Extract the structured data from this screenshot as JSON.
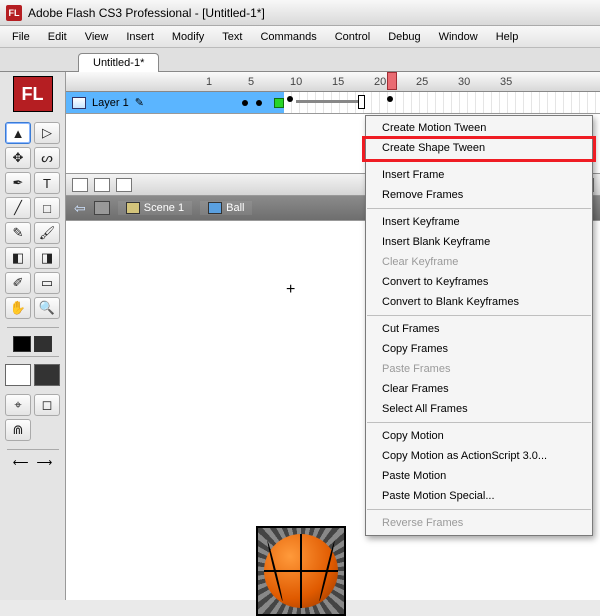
{
  "titlebar": {
    "app": "FL",
    "title": "Adobe Flash CS3 Professional - [Untitled-1*]"
  },
  "menubar": [
    "File",
    "Edit",
    "View",
    "Insert",
    "Modify",
    "Text",
    "Commands",
    "Control",
    "Debug",
    "Window",
    "Help"
  ],
  "tab": "Untitled-1*",
  "timeline": {
    "layer": "Layer 1",
    "nums": [
      "1",
      "5",
      "10",
      "15",
      "20",
      "25",
      "30",
      "35"
    ]
  },
  "breadcrumb": {
    "scene": "Scene 1",
    "symbol": "Ball"
  },
  "context": {
    "items": [
      {
        "label": "Create Motion Tween",
        "dis": false
      },
      {
        "label": "Create Shape Tween",
        "dis": false,
        "hl": true
      },
      {
        "sep": true
      },
      {
        "label": "Insert Frame",
        "dis": false
      },
      {
        "label": "Remove Frames",
        "dis": false
      },
      {
        "sep": true
      },
      {
        "label": "Insert Keyframe",
        "dis": false
      },
      {
        "label": "Insert Blank Keyframe",
        "dis": false
      },
      {
        "label": "Clear Keyframe",
        "dis": true
      },
      {
        "label": "Convert to Keyframes",
        "dis": false
      },
      {
        "label": "Convert to Blank Keyframes",
        "dis": false
      },
      {
        "sep": true
      },
      {
        "label": "Cut Frames",
        "dis": false
      },
      {
        "label": "Copy Frames",
        "dis": false
      },
      {
        "label": "Paste Frames",
        "dis": true
      },
      {
        "label": "Clear Frames",
        "dis": false
      },
      {
        "label": "Select All Frames",
        "dis": false
      },
      {
        "sep": true
      },
      {
        "label": "Copy Motion",
        "dis": false
      },
      {
        "label": "Copy Motion as ActionScript 3.0...",
        "dis": false
      },
      {
        "label": "Paste Motion",
        "dis": false
      },
      {
        "label": "Paste Motion Special...",
        "dis": false
      },
      {
        "sep": true
      },
      {
        "label": "Reverse Frames",
        "dis": true
      }
    ]
  },
  "tools": {
    "badge": "FL",
    "items": [
      {
        "n": "selection",
        "g": "▲",
        "sel": true
      },
      {
        "n": "subselect",
        "g": "▷"
      },
      {
        "n": "free-transform",
        "g": "✥"
      },
      {
        "n": "lasso",
        "g": "ᔕ"
      },
      {
        "n": "pen",
        "g": "✒"
      },
      {
        "n": "text",
        "g": "T"
      },
      {
        "n": "line",
        "g": "╱"
      },
      {
        "n": "rectangle",
        "g": "□"
      },
      {
        "n": "pencil",
        "g": "✎"
      },
      {
        "n": "brush",
        "g": "🖌"
      },
      {
        "n": "ink-bottle",
        "g": "◧"
      },
      {
        "n": "paint-bucket",
        "g": "◨"
      },
      {
        "n": "eyedropper",
        "g": "✐"
      },
      {
        "n": "eraser",
        "g": "▭"
      },
      {
        "n": "hand",
        "g": "✋"
      },
      {
        "n": "zoom",
        "g": "🔍"
      }
    ]
  }
}
